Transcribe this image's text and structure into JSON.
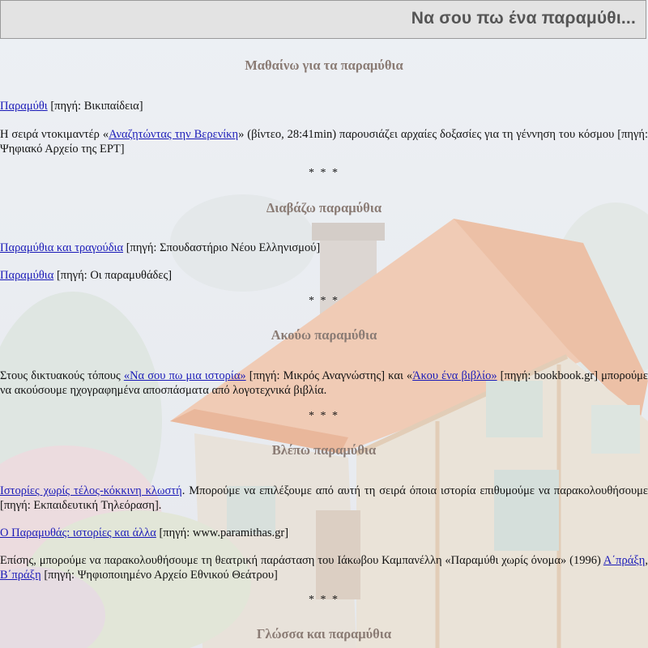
{
  "header": {
    "title": "Να σου πω ένα παραμύθι..."
  },
  "separator": "* * *",
  "sections": {
    "learn": {
      "heading": "Μαθαίνω για τα παραμύθια",
      "p1": {
        "link": "Παραμύθι",
        "after": " [πηγή: Βικιπαίδεια]"
      },
      "p2": {
        "before": "Η σειρά ντοκιμαντέρ «",
        "link": "Αναζητώντας την Βερενίκη",
        "after": "» (βίντεο, 28:41min) παρουσιάζει αρχαίες δοξασίες για τη γέννηση του κόσμου [πηγή: Ψηφιακό Αρχείο της ΕΡΤ]"
      }
    },
    "read": {
      "heading": "Διαβάζω παραμύθια",
      "p1": {
        "link": "Παραμύθια και τραγούδια",
        "after": " [πηγή: Σπουδαστήριο Νέου Ελληνισμού]"
      },
      "p2": {
        "link": "Παραμύθια",
        "after": " [πηγή: Οι παραμυθάδες]"
      }
    },
    "listen": {
      "heading": "Ακούω παραμύθια",
      "p1": {
        "before": "Στους δικτυακούς τόπους ",
        "link1": "«Να σου πω μια ιστορία»",
        "middle": " [πηγή: Μικρός Αναγνώστης] και «",
        "link2": "Άκου ένα βιβλίο»",
        "after": " [πηγή: bookbook.gr] μπορούμε να ακούσουμε ηχογραφημένα αποσπάσματα από λογοτεχνικά βιβλία."
      }
    },
    "watch": {
      "heading": "Βλέπω παραμύθια",
      "p1": {
        "link": "Ιστορίες χωρίς τέλος-κόκκινη κλωστή",
        "after": ". Μπορούμε να επιλέξουμε από αυτή τη σειρά όποια ιστορία επιθυμούμε να παρακολουθήσουμε [πηγή: Εκπαιδευτική Τηλεόραση]."
      },
      "p2": {
        "link": "Ο Παραμυθάς: ιστορίες και άλλα",
        "after": " [πηγή: www.paramithas.gr]"
      },
      "p3": {
        "before": "Επίσης, μπορούμε να παρακολουθήσουμε τη θεατρική παράσταση του Ιάκωβου Καμπανέλλη «Παραμύθι χωρίς όνομα» (1996) ",
        "link1": "Α΄πράξη",
        "middle": ", ",
        "link2": "Β΄πράξη",
        "after": " [πηγή: Ψηφιοποιημένο Αρχείο Εθνικού Θεάτρου]"
      }
    },
    "language": {
      "heading": "Γλώσσα και παραμύθια"
    }
  }
}
